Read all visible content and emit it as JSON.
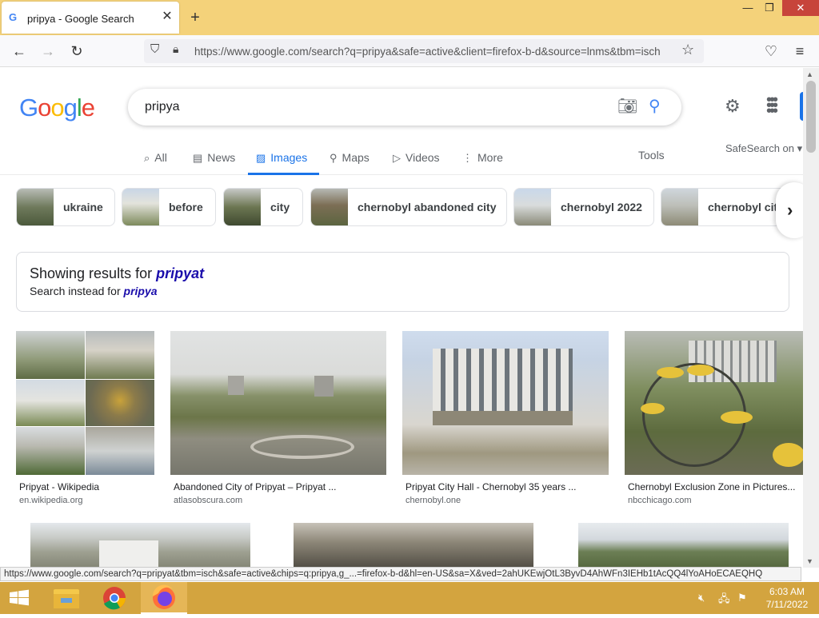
{
  "browser": {
    "tab_title": "pripya - Google Search",
    "tab_close": "✕",
    "new_tab": "+",
    "favicon": "G",
    "url": "https://www.google.com/search?q=pripya&safe=active&client=firefox-b-d&source=lnms&tbm=isch",
    "window_controls": {
      "minimize": "—",
      "restore": "❐",
      "close": "✕"
    },
    "status_url": "https://www.google.com/search?q=pripyat&tbm=isch&safe=active&chips=q:pripya,g_...=firefox-b-d&hl=en-US&sa=X&ved=2ahUKEwjOtL3ByvD4AhWFn3IEHb1tAcQQ4lYoAHoECAEQHQ"
  },
  "google": {
    "logo_letters": [
      "G",
      "o",
      "o",
      "g",
      "l",
      "e"
    ],
    "logo_colors": [
      "#4285f4",
      "#ea4335",
      "#fbbc05",
      "#4285f4",
      "#34a853",
      "#ea4335"
    ],
    "query": "pripya",
    "tabs": [
      {
        "label": "All",
        "icon": "search-icon",
        "glyph": "⌕"
      },
      {
        "label": "News",
        "icon": "news-icon",
        "glyph": "▤"
      },
      {
        "label": "Images",
        "icon": "image-icon",
        "glyph": "▨",
        "active": true
      },
      {
        "label": "Maps",
        "icon": "pin-icon",
        "glyph": "⚲"
      },
      {
        "label": "Videos",
        "icon": "play-icon",
        "glyph": "▷"
      },
      {
        "label": "More",
        "icon": "more-vert-icon",
        "glyph": "⋮"
      }
    ],
    "tools_label": "Tools",
    "safesearch_label": "SafeSearch on ▾",
    "chips": [
      {
        "label": "ukraine"
      },
      {
        "label": "before"
      },
      {
        "label": "city"
      },
      {
        "label": "chernobyl abandoned city"
      },
      {
        "label": "chernobyl 2022"
      },
      {
        "label": "chernobyl cit"
      }
    ],
    "correction": {
      "showing_prefix": "Showing results for ",
      "corrected": "pripyat",
      "instead_prefix": "Search instead for ",
      "original": "pripya"
    },
    "results": [
      {
        "caption": "Pripyat - Wikipedia",
        "source": "en.wikipedia.org"
      },
      {
        "caption": "Abandoned City of Pripyat – Pripyat ...",
        "source": "atlasobscura.com"
      },
      {
        "caption": "Pripyat City Hall - Chernobyl 35 years ...",
        "source": "chernobyl.one"
      },
      {
        "caption": "Chernobyl Exclusion Zone in Pictures...",
        "source": "nbcchicago.com"
      }
    ]
  },
  "taskbar": {
    "time": "6:03 AM",
    "date": "7/11/2022"
  }
}
